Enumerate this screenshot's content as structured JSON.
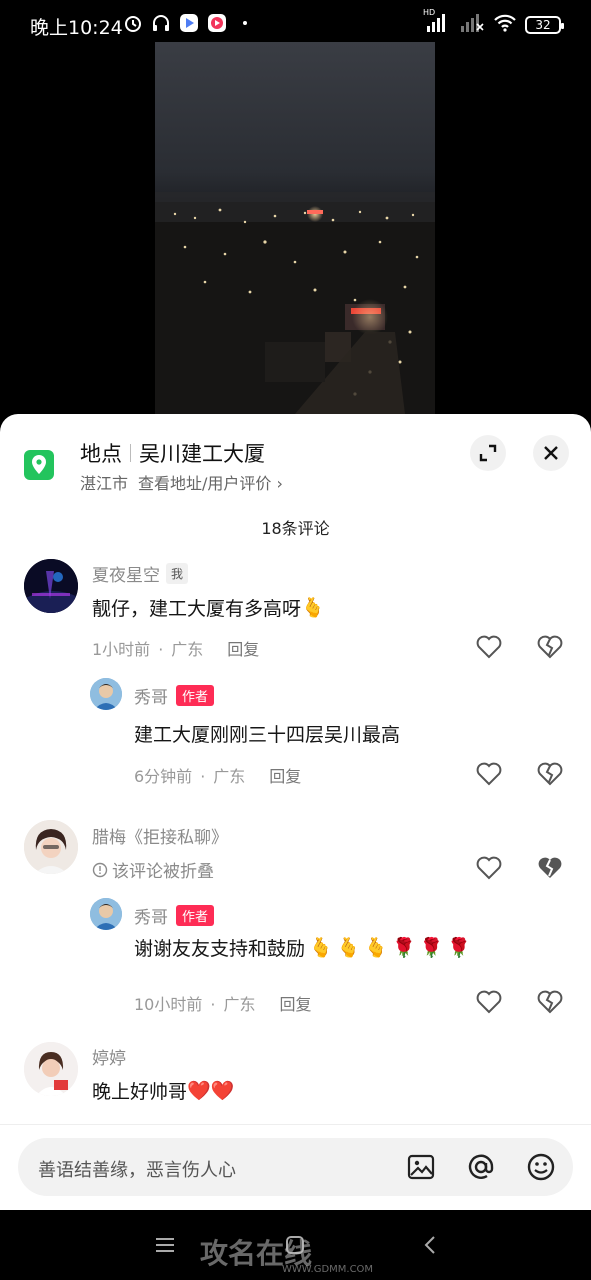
{
  "status_bar": {
    "time": "晚上10:24",
    "network": "HD",
    "battery": "32"
  },
  "location": {
    "label": "地点",
    "name": "吴川建工大厦",
    "city": "湛江市",
    "link": "查看地址/用户评价",
    "link_chevron": "›"
  },
  "comment_count": "18条评论",
  "comments": [
    {
      "user": "夏夜星空",
      "badge": "我",
      "text": "靓仔，建工大厦有多高呀",
      "emoji": "🫰",
      "time": "1小时前",
      "region": "广东",
      "reply": "回复"
    },
    {
      "user": "秀哥",
      "badge": "作者",
      "text": "建工大厦刚刚三十四层吴川最高",
      "time": "6分钟前",
      "region": "广东",
      "reply": "回复"
    },
    {
      "user": "腊梅《拒接私聊》",
      "folded": "该评论被折叠"
    },
    {
      "user": "秀哥",
      "badge": "作者",
      "text": "谢谢友友支持和鼓励",
      "emoji": "🫰🫰🫰🌹🌹🌹",
      "time": "10小时前",
      "region": "广东",
      "reply": "回复"
    },
    {
      "user": "婷婷",
      "text": "晚上好帅哥",
      "emoji": "❤️❤️"
    }
  ],
  "input": {
    "placeholder": "善语结善缘，恶言伤人心"
  },
  "watermark": {
    "text": "攻名在线",
    "url": "WWW.GDMM.COM"
  },
  "colors": {
    "location_green": "#23c45d",
    "author_red": "#fe2c55"
  }
}
